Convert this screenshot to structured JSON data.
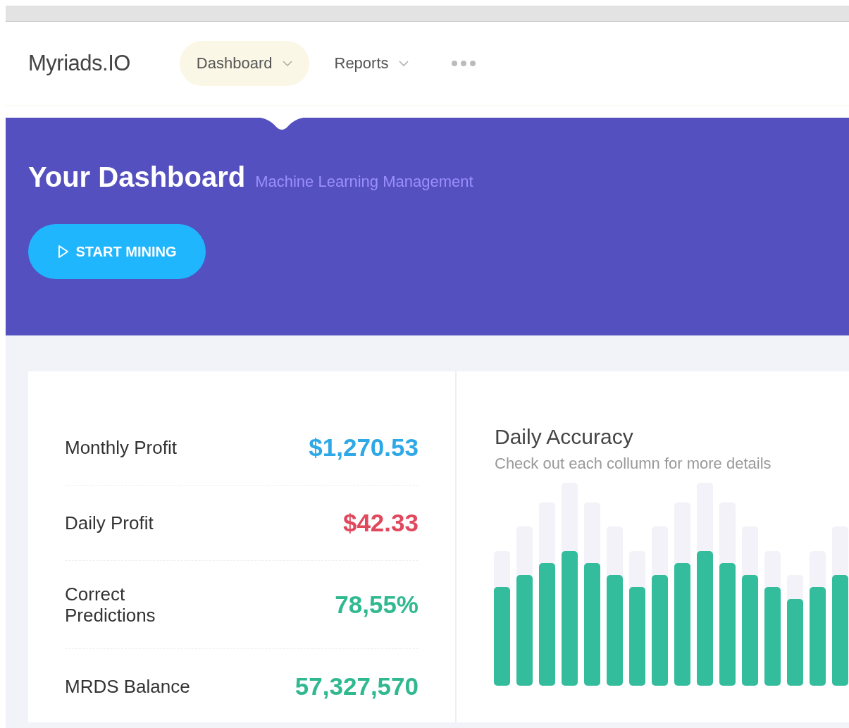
{
  "brand": "Myriads.IO",
  "nav": [
    {
      "label": "Dashboard",
      "selected": true
    },
    {
      "label": "Reports",
      "selected": false
    }
  ],
  "hero": {
    "title": "Your Dashboard",
    "subtitle": "Machine Learning Management",
    "button": "START MINING"
  },
  "stats": [
    {
      "label": "Monthly Profit",
      "value": "$1,270.53",
      "color": "#2ea8e6"
    },
    {
      "label": "Daily Profit",
      "value": "$42.33",
      "color": "#e0485c"
    },
    {
      "label": "Correct Predictions",
      "value": "78,55%",
      "color": "#30b990"
    },
    {
      "label": "MRDS Balance",
      "value": "57,327,570",
      "color": "#30b990"
    }
  ],
  "accuracy": {
    "title": "Daily Accuracy",
    "subtitle": "Check out each collumn for more details"
  }
}
